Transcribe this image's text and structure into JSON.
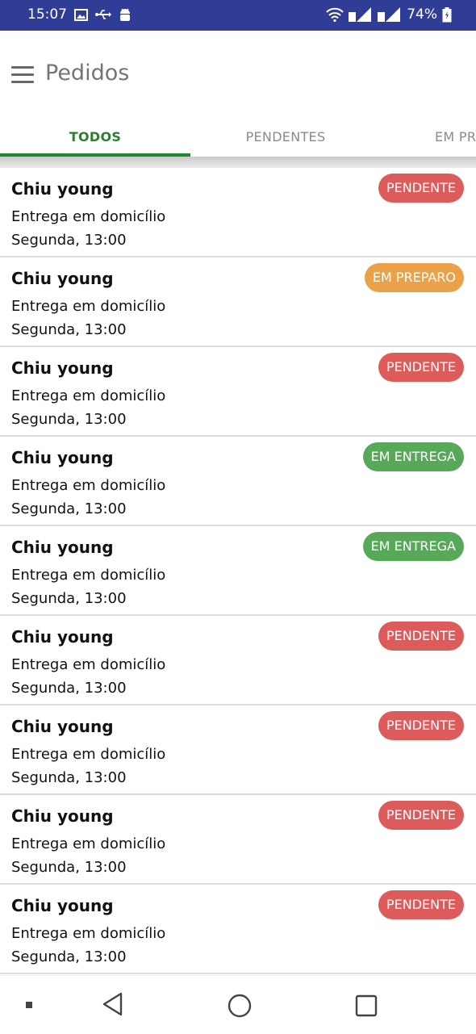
{
  "status_bar": {
    "time": "15:07",
    "battery": "74%",
    "icons_left": [
      "image-icon",
      "usb-icon",
      "android-debug-icon"
    ],
    "icons_right": [
      "wifi-icon",
      "signal-icon",
      "signal-icon",
      "battery-icon"
    ]
  },
  "app_bar": {
    "title": "Pedidos",
    "menu_icon": "hamburger-menu-icon"
  },
  "tabs": [
    {
      "label": "TODOS",
      "active": true
    },
    {
      "label": "PENDENTES",
      "active": false
    },
    {
      "label": "EM PR",
      "active": false
    }
  ],
  "colors": {
    "status_bar": "#2f3d96",
    "tab_active": "#2e7d32",
    "pendente": "#dd5b5b",
    "em_preparo": "#eaa14a",
    "em_entrega": "#58a85a"
  },
  "orders": [
    {
      "name": "Chiu young",
      "type": "Entrega em domicílio",
      "time": "Segunda, 13:00",
      "status": "PENDENTE",
      "status_color": "#dd5b5b"
    },
    {
      "name": "Chiu young",
      "type": "Entrega em domicílio",
      "time": "Segunda, 13:00",
      "status": "EM PREPARO",
      "status_color": "#eaa14a"
    },
    {
      "name": "Chiu young",
      "type": "Entrega em domicílio",
      "time": "Segunda, 13:00",
      "status": "PENDENTE",
      "status_color": "#dd5b5b"
    },
    {
      "name": "Chiu young",
      "type": "Entrega em domicílio",
      "time": "Segunda, 13:00",
      "status": "EM ENTREGA",
      "status_color": "#58a85a"
    },
    {
      "name": "Chiu young",
      "type": "Entrega em domicílio",
      "time": "Segunda, 13:00",
      "status": "EM ENTREGA",
      "status_color": "#58a85a"
    },
    {
      "name": "Chiu young",
      "type": "Entrega em domicílio",
      "time": "Segunda, 13:00",
      "status": "PENDENTE",
      "status_color": "#dd5b5b"
    },
    {
      "name": "Chiu young",
      "type": "Entrega em domicílio",
      "time": "Segunda, 13:00",
      "status": "PENDENTE",
      "status_color": "#dd5b5b"
    },
    {
      "name": "Chiu young",
      "type": "Entrega em domicílio",
      "time": "Segunda, 13:00",
      "status": "PENDENTE",
      "status_color": "#dd5b5b"
    },
    {
      "name": "Chiu young",
      "type": "Entrega em domicílio",
      "time": "Segunda, 13:00",
      "status": "PENDENTE",
      "status_color": "#dd5b5b"
    }
  ],
  "nav_bar": [
    "square-dot-icon",
    "back-icon",
    "home-icon",
    "recents-icon"
  ]
}
